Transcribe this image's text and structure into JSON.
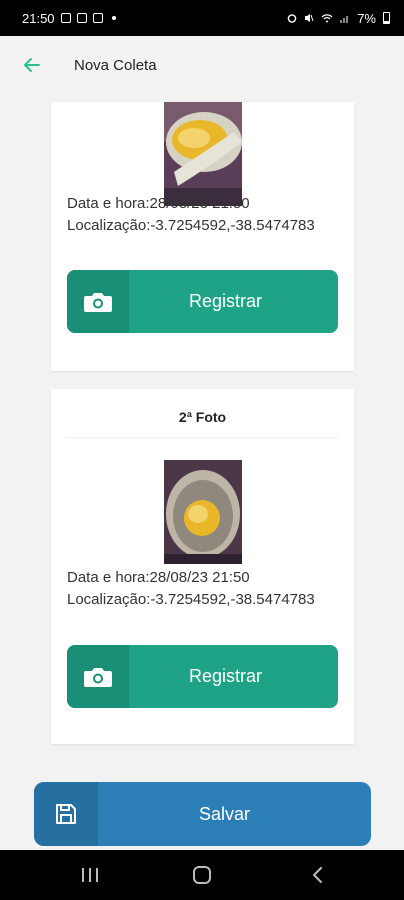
{
  "status_bar": {
    "time": "21:50",
    "battery": "7%"
  },
  "app_bar": {
    "title": "Nova Coleta",
    "back_icon": "arrow-left-icon"
  },
  "cards": [
    {
      "title": "",
      "datetime": "Data e hora:28/08/23 21:50",
      "location": "Localização:-3.7254592,-38.5474783",
      "button_label": "Registrar",
      "button_icon": "camera-icon"
    },
    {
      "title": "2ª Foto",
      "datetime": "Data e hora:28/08/23 21:50",
      "location": "Localização:-3.7254592,-38.5474783",
      "button_label": "Registrar",
      "button_icon": "camera-icon"
    }
  ],
  "save_button": {
    "label": "Salvar",
    "icon": "floppy-disk-icon"
  },
  "colors": {
    "accent_green": "#1fa386",
    "accent_blue": "#2b7fb6",
    "back_arrow": "#2bbf8f"
  }
}
